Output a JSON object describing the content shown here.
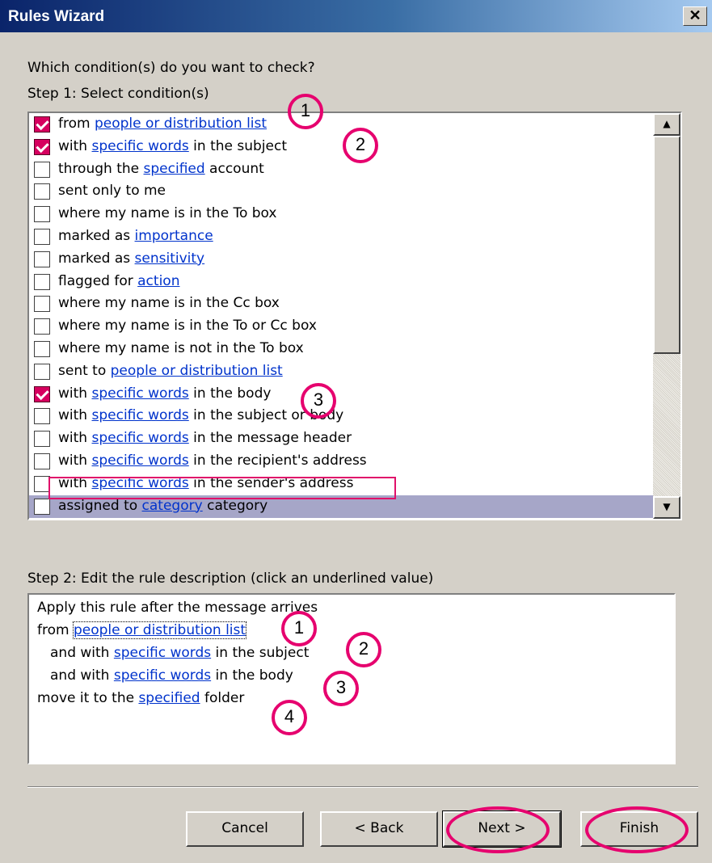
{
  "window": {
    "title": "Rules Wizard",
    "close_glyph": "✕"
  },
  "question": "Which condition(s) do you want to check?",
  "step1_label": "Step 1: Select condition(s)",
  "conditions": [
    {
      "pre": "from ",
      "link": "people or distribution list",
      "post": "",
      "checked": true,
      "selected": false
    },
    {
      "pre": "with ",
      "link": "specific words",
      "post": " in the subject",
      "checked": true,
      "selected": false
    },
    {
      "pre": "through the ",
      "link": "specified",
      "post": " account",
      "checked": false,
      "selected": false
    },
    {
      "pre": "sent only to me",
      "link": "",
      "post": "",
      "checked": false,
      "selected": false
    },
    {
      "pre": "where my name is in the To box",
      "link": "",
      "post": "",
      "checked": false,
      "selected": false
    },
    {
      "pre": "marked as ",
      "link": "importance",
      "post": "",
      "checked": false,
      "selected": false
    },
    {
      "pre": "marked as ",
      "link": "sensitivity",
      "post": "",
      "checked": false,
      "selected": false
    },
    {
      "pre": "flagged for ",
      "link": "action",
      "post": "",
      "checked": false,
      "selected": false
    },
    {
      "pre": "where my name is in the Cc box",
      "link": "",
      "post": "",
      "checked": false,
      "selected": false
    },
    {
      "pre": "where my name is in the To or Cc box",
      "link": "",
      "post": "",
      "checked": false,
      "selected": false
    },
    {
      "pre": "where my name is not in the To box",
      "link": "",
      "post": "",
      "checked": false,
      "selected": false
    },
    {
      "pre": "sent to ",
      "link": "people or distribution list",
      "post": "",
      "checked": false,
      "selected": false
    },
    {
      "pre": "with ",
      "link": "specific words",
      "post": " in the body",
      "checked": true,
      "selected": false
    },
    {
      "pre": "with ",
      "link": "specific words",
      "post": " in the subject or body",
      "checked": false,
      "selected": false
    },
    {
      "pre": "with ",
      "link": "specific words",
      "post": " in the message header",
      "checked": false,
      "selected": false
    },
    {
      "pre": "with ",
      "link": "specific words",
      "post": " in the recipient's address",
      "checked": false,
      "selected": false
    },
    {
      "pre": "with ",
      "link": "specific words",
      "post": " in the sender's address",
      "checked": false,
      "selected": false
    },
    {
      "pre": "assigned to ",
      "link": "category",
      "post": " category",
      "checked": false,
      "selected": true
    }
  ],
  "step2_label": "Step 2: Edit the rule description (click an underlined value)",
  "description": {
    "line1": "Apply this rule after the message arrives",
    "line2_pre": "from ",
    "line2_link": "people or distribution list",
    "line3_pre": "and with ",
    "line3_link": "specific words",
    "line3_post": " in the subject",
    "line4_pre": "and with ",
    "line4_link": "specific words",
    "line4_post": " in the body",
    "line5_pre": "move it to the ",
    "line5_link": "specified",
    "line5_post": " folder"
  },
  "buttons": {
    "cancel": "Cancel",
    "back": "< Back",
    "next": "Next >",
    "finish": "Finish"
  },
  "annotations": {
    "n1": "1",
    "n2": "2",
    "n3": "3",
    "n4": "4"
  },
  "colors": {
    "annotation": "#e6006e",
    "checkbox_checked": "#d6005f",
    "link": "#0033cc"
  }
}
